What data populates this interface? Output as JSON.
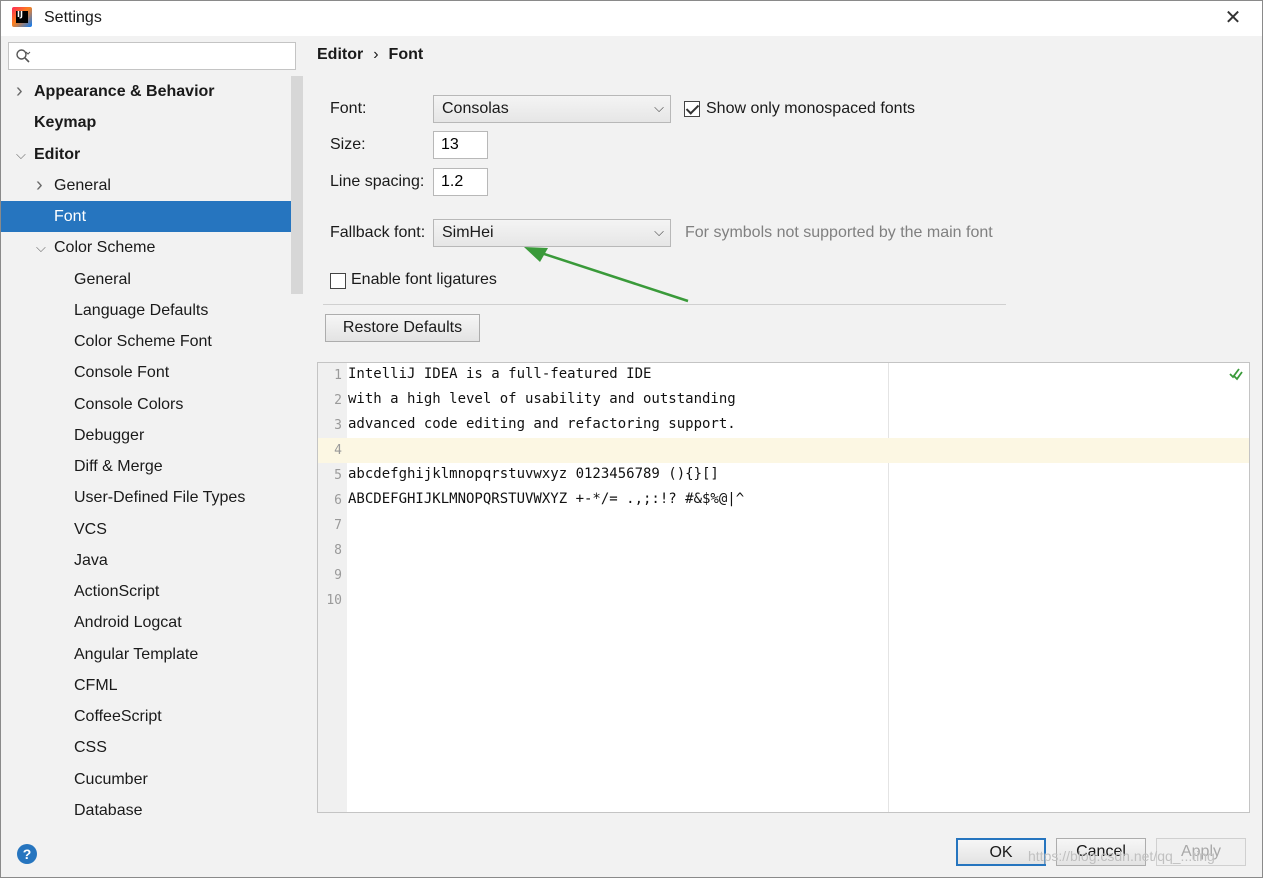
{
  "window": {
    "title": "Settings",
    "close_glyph": "✕"
  },
  "search": {
    "placeholder": "",
    "value": ""
  },
  "sidebar": {
    "items": [
      {
        "label": "Appearance & Behavior",
        "level": 0,
        "bold": true,
        "expand": "collapsed"
      },
      {
        "label": "Keymap",
        "level": 0,
        "bold": true,
        "expand": "none"
      },
      {
        "label": "Editor",
        "level": 0,
        "bold": true,
        "expand": "expanded"
      },
      {
        "label": "General",
        "level": 1,
        "bold": false,
        "expand": "collapsed"
      },
      {
        "label": "Font",
        "level": 1,
        "bold": false,
        "expand": "none",
        "selected": true
      },
      {
        "label": "Color Scheme",
        "level": 1,
        "bold": false,
        "expand": "expanded"
      },
      {
        "label": "General",
        "level": 2,
        "bold": false,
        "expand": "none"
      },
      {
        "label": "Language Defaults",
        "level": 2,
        "bold": false,
        "expand": "none"
      },
      {
        "label": "Color Scheme Font",
        "level": 2,
        "bold": false,
        "expand": "none"
      },
      {
        "label": "Console Font",
        "level": 2,
        "bold": false,
        "expand": "none"
      },
      {
        "label": "Console Colors",
        "level": 2,
        "bold": false,
        "expand": "none"
      },
      {
        "label": "Debugger",
        "level": 2,
        "bold": false,
        "expand": "none"
      },
      {
        "label": "Diff & Merge",
        "level": 2,
        "bold": false,
        "expand": "none"
      },
      {
        "label": "User-Defined File Types",
        "level": 2,
        "bold": false,
        "expand": "none"
      },
      {
        "label": "VCS",
        "level": 2,
        "bold": false,
        "expand": "none"
      },
      {
        "label": "Java",
        "level": 2,
        "bold": false,
        "expand": "none"
      },
      {
        "label": "ActionScript",
        "level": 2,
        "bold": false,
        "expand": "none"
      },
      {
        "label": "Android Logcat",
        "level": 2,
        "bold": false,
        "expand": "none"
      },
      {
        "label": "Angular Template",
        "level": 2,
        "bold": false,
        "expand": "none"
      },
      {
        "label": "CFML",
        "level": 2,
        "bold": false,
        "expand": "none"
      },
      {
        "label": "CoffeeScript",
        "level": 2,
        "bold": false,
        "expand": "none"
      },
      {
        "label": "CSS",
        "level": 2,
        "bold": false,
        "expand": "none"
      },
      {
        "label": "Cucumber",
        "level": 2,
        "bold": false,
        "expand": "none"
      },
      {
        "label": "Database",
        "level": 2,
        "bold": false,
        "expand": "none"
      }
    ]
  },
  "breadcrumb": {
    "parent": "Editor",
    "separator": "›",
    "current": "Font"
  },
  "font_settings": {
    "font_label": "Font:",
    "font_value": "Consolas",
    "mono_only_label": "Show only monospaced fonts",
    "mono_only_checked": true,
    "size_label": "Size:",
    "size_value": "13",
    "line_spacing_label": "Line spacing:",
    "line_spacing_value": "1.2",
    "fallback_label": "Fallback font:",
    "fallback_value": "SimHei",
    "fallback_hint": "For symbols not supported by the main font",
    "ligatures_label": "Enable font ligatures",
    "ligatures_checked": false,
    "restore_label": "Restore Defaults"
  },
  "preview": {
    "lines": [
      {
        "num": "1",
        "text": "IntelliJ IDEA is a full-featured IDE"
      },
      {
        "num": "2",
        "text": "with a high level of usability and outstanding"
      },
      {
        "num": "3",
        "text": "advanced code editing and refactoring support."
      },
      {
        "num": "4",
        "text": "",
        "current": true
      },
      {
        "num": "5",
        "text": "abcdefghijklmnopqrstuvwxyz 0123456789 (){}[]"
      },
      {
        "num": "6",
        "text": "ABCDEFGHIJKLMNOPQRSTUVWXYZ +-*/= .,;:!? #&$%@|^"
      },
      {
        "num": "7",
        "text": ""
      },
      {
        "num": "8",
        "text": ""
      },
      {
        "num": "9",
        "text": ""
      },
      {
        "num": "10",
        "text": ""
      }
    ]
  },
  "footer": {
    "help_glyph": "?",
    "ok_label": "OK",
    "cancel_label": "Cancel",
    "apply_label": "Apply",
    "watermark": "https://blog.csdn.net/qq_...ting"
  },
  "colors": {
    "selection": "#2675bf",
    "arrow": "#3a9a3a",
    "current_line": "#fcf7e3"
  }
}
